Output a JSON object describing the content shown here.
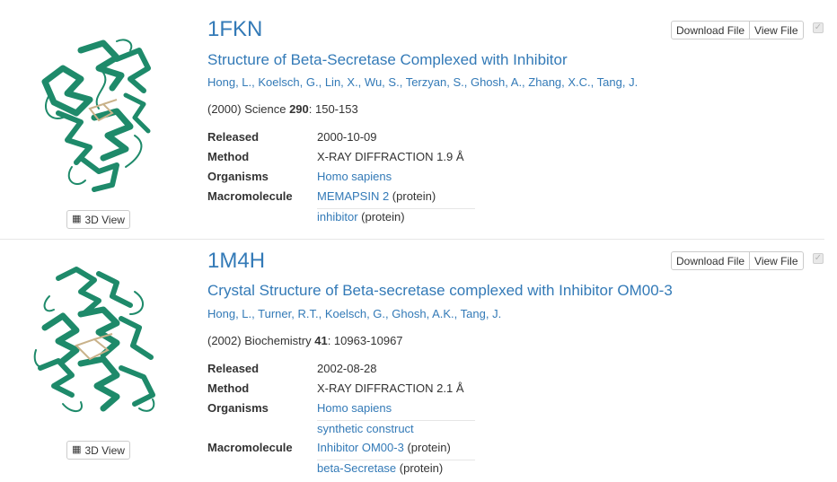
{
  "results": [
    {
      "id": "1FKN",
      "title": "Structure of Beta-Secretase Complexed with Inhibitor",
      "authors": [
        "Hong, L.,",
        "Koelsch, G.,",
        "Lin, X.,",
        "Wu, S.,",
        "Terzyan, S.,",
        "Ghosh, A.,",
        "Zhang, X.C.,",
        "Tang, J."
      ],
      "citation": {
        "prefix": "(2000) Science ",
        "volume": "290",
        "pages": ": 150-153"
      },
      "labels": {
        "released": "Released",
        "method": "Method",
        "organisms": "Organisms",
        "macromolecule": "Macromolecule"
      },
      "released": "2000-10-09",
      "method": "X-RAY DIFFRACTION 1.9 Å",
      "organisms": [
        "Homo sapiens"
      ],
      "macromolecules": [
        {
          "name": "MEMAPSIN 2",
          "type": " (protein)"
        },
        {
          "name": "inhibitor",
          "type": " (protein)"
        }
      ],
      "buttons": {
        "download": "Download File",
        "view": "View File",
        "view3d": "3D View"
      }
    },
    {
      "id": "1M4H",
      "title": "Crystal Structure of Beta-secretase complexed with Inhibitor OM00-3",
      "authors": [
        "Hong, L.,",
        "Turner, R.T.,",
        "Koelsch, G.,",
        "Ghosh, A.K.,",
        "Tang, J."
      ],
      "citation": {
        "prefix": "(2002) Biochemistry ",
        "volume": "41",
        "pages": ": 10963-10967"
      },
      "labels": {
        "released": "Released",
        "method": "Method",
        "organisms": "Organisms",
        "macromolecule": "Macromolecule"
      },
      "released": "2002-08-28",
      "method": "X-RAY DIFFRACTION 2.1 Å",
      "organisms": [
        "Homo sapiens",
        "synthetic construct"
      ],
      "macromolecules": [
        {
          "name": "Inhibitor OM00-3",
          "type": " (protein)"
        },
        {
          "name": "beta-Secretase",
          "type": " (protein)"
        }
      ],
      "buttons": {
        "download": "Download File",
        "view": "View File",
        "view3d": "3D View"
      }
    }
  ],
  "icons": {
    "cube": "cube-icon",
    "check": "checkmark-icon"
  },
  "colors": {
    "link": "#337ab7",
    "protein_ribbon": "#1e8a6a",
    "ligand": "#c9b28a"
  }
}
